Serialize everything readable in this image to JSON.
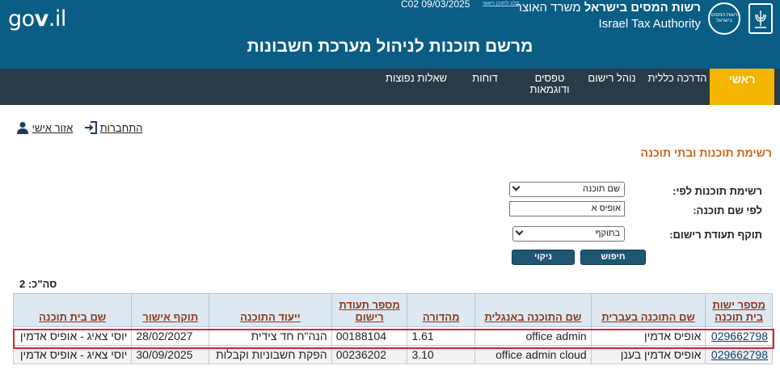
{
  "header": {
    "gov_logo_prefix": "go",
    "gov_logo_v": "v",
    "gov_logo_suffix": ".il",
    "version": "C02 09/03/2025",
    "accessibility_link": "דלג לתוכן ראשי",
    "authority_he_bold": "רשות המסים בישראל",
    "authority_he_rest": "משרד האוצר",
    "authority_en": "Israel Tax Authority",
    "emblem_text": "רשות המסים בישראל",
    "title": "מרשם תוכנות לניהול מערכת חשבונות"
  },
  "nav": {
    "items": [
      {
        "label": "ראשי",
        "active": true
      },
      {
        "label": "הדרכה כללית"
      },
      {
        "label": "נוהל רישום"
      },
      {
        "label": "טפסים ודוגמאות"
      },
      {
        "label": "דוחות"
      },
      {
        "label": "שאלות נפוצות"
      }
    ]
  },
  "personal": {
    "login": "התחברות",
    "personal_area": "אזור אישי"
  },
  "section_title": "רשימת תוכנות ובתי תוכנה",
  "form": {
    "list_by_label": "רשימת תוכנות לפי:",
    "list_by_value": "שם תוכנה",
    "name_label": "לפי שם תוכנה:",
    "name_value": "אופיס א",
    "validity_label": "תוקף תעודת רישום:",
    "validity_value": "בתוקף",
    "search_button": "חיפוש",
    "clear_button": "ניקוי"
  },
  "total_label": "סה\"כ: 2",
  "table": {
    "headers": [
      "מספר ישות בית תוכנה",
      "שם התוכנה בעברית",
      "שם התוכנה באנגלית",
      "מהדורה",
      "מספר תעודת רישום",
      "ייעוד התוכנה",
      "תוקף אישור",
      "שם בית תוכנה"
    ],
    "rows": [
      [
        "029662798",
        "אופיס אדמין",
        "office admin",
        "1.61",
        "00188104",
        "הנה\"ח חד צידית",
        "28/02/2027",
        "יוסי צאיג - אופיס אדמין"
      ],
      [
        "029662798",
        "אופיס אדמין בענן",
        "office admin cloud",
        "3.10",
        "00236202",
        "הפקת חשבוניות וקבלות",
        "30/09/2025",
        "יוסי צאיג - אופיס אדמין"
      ]
    ]
  },
  "colors": {
    "header_bg": "#0a5d85",
    "nav_bg": "#2a3b48",
    "nav_active": "#f5b400",
    "section_title": "#c8651b",
    "highlight": "#d9223c"
  }
}
